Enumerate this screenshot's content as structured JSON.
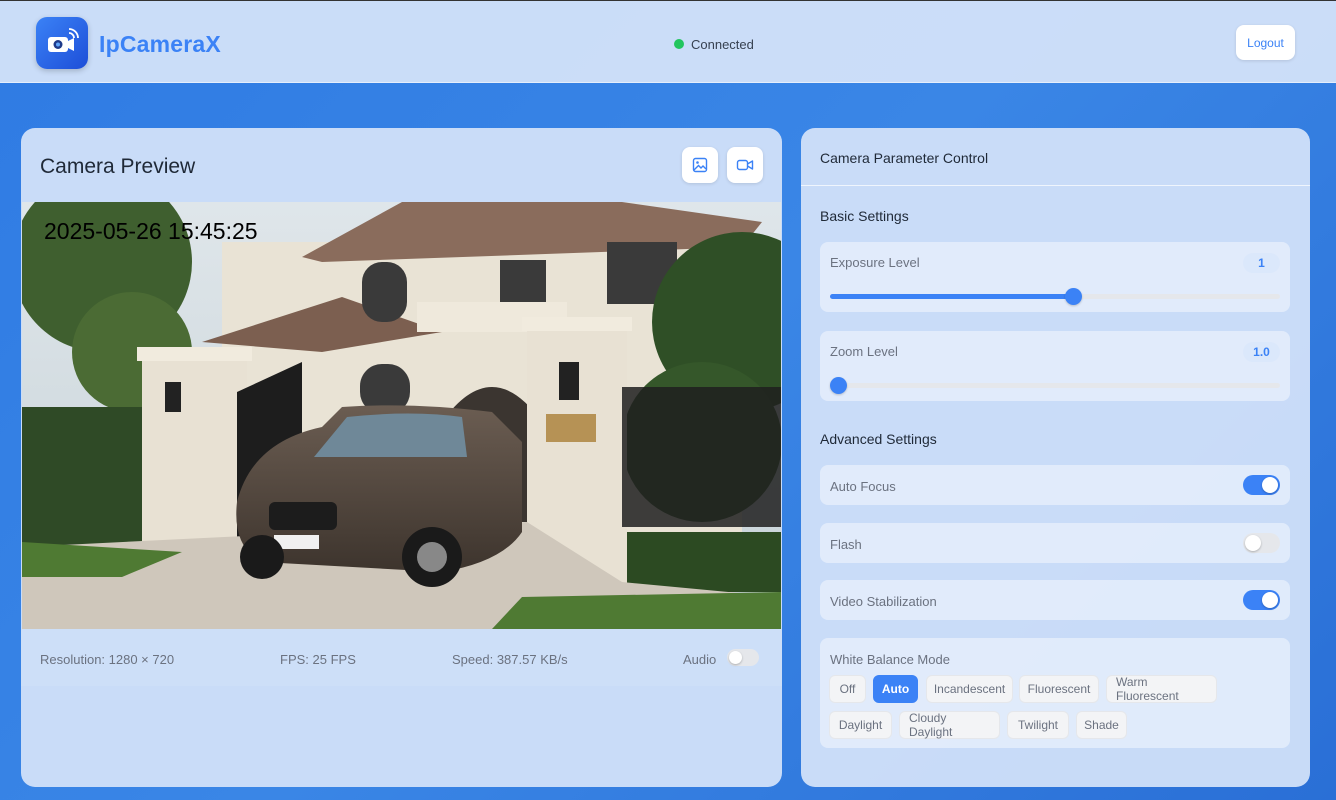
{
  "header": {
    "brand": "IpCameraX",
    "status": "Connected",
    "logout_label": "Logout"
  },
  "preview": {
    "title": "Camera Preview",
    "timestamp": "2025-05-26 15:45:25",
    "resolution": "Resolution: 1280 × 720",
    "fps": "FPS: 25 FPS",
    "speed": "Speed: 387.57 KB/s",
    "audio_label": "Audio",
    "audio_enabled": false
  },
  "controls": {
    "title": "Camera Parameter Control",
    "basic_title": "Basic Settings",
    "exposure": {
      "label": "Exposure Level",
      "value": "1",
      "fraction": 0.54
    },
    "zoom": {
      "label": "Zoom Level",
      "value": "1.0",
      "fraction": 0.0
    },
    "advanced_title": "Advanced Settings",
    "auto_focus": {
      "label": "Auto Focus",
      "enabled": true
    },
    "flash": {
      "label": "Flash",
      "enabled": false
    },
    "stabilization": {
      "label": "Video Stabilization",
      "enabled": true
    },
    "white_balance": {
      "label": "White Balance Mode",
      "selected": "Auto",
      "options": [
        "Off",
        "Auto",
        "Incandescent",
        "Fluorescent",
        "Warm Fluorescent",
        "Daylight",
        "Cloudy Daylight",
        "Twilight",
        "Shade"
      ]
    }
  },
  "colors": {
    "accent": "#3b82f6",
    "status_green": "#22c55e"
  }
}
